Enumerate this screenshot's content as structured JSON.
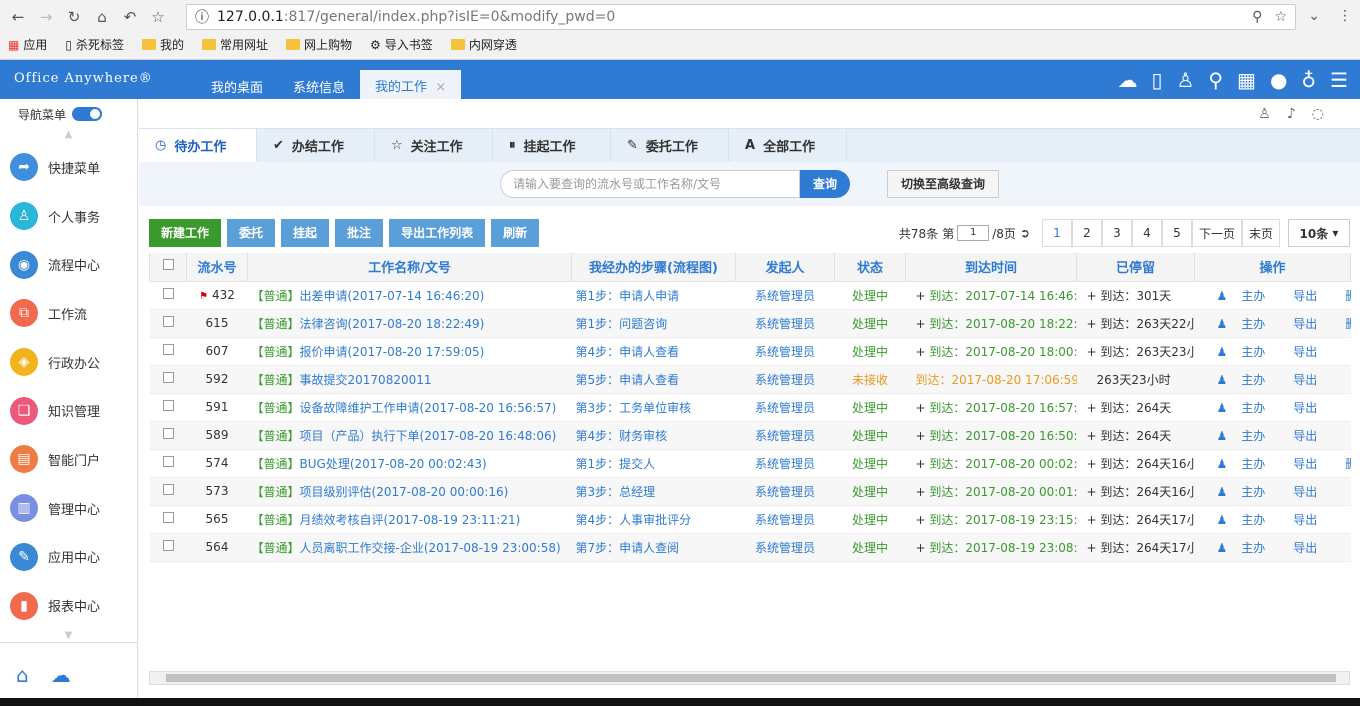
{
  "browser": {
    "url_host": "127.0.0.1",
    "url_rest": ":817/general/index.php?isIE=0&modify_pwd=0",
    "bookmarks": [
      "应用",
      "杀死标签",
      "我的",
      "常用网址",
      "网上购物",
      "导入书签",
      "内网穿透"
    ]
  },
  "app": {
    "logo": "Office Anywhere®",
    "top_tabs": [
      "我的桌面",
      "系统信息",
      "我的工作"
    ],
    "active_tab_close": "×"
  },
  "sidebar": {
    "toggle_label": "导航菜单",
    "items": [
      {
        "label": "快捷菜单",
        "color": "#3f8fdc"
      },
      {
        "label": "个人事务",
        "color": "#29b6d9"
      },
      {
        "label": "流程中心",
        "color": "#3a89d4"
      },
      {
        "label": "工作流",
        "color": "#f26a4e"
      },
      {
        "label": "行政办公",
        "color": "#f2b41e"
      },
      {
        "label": "知识管理",
        "color": "#ec5a7b"
      },
      {
        "label": "智能门户",
        "color": "#ef7c45"
      },
      {
        "label": "管理中心",
        "color": "#7a8fe0"
      },
      {
        "label": "应用中心",
        "color": "#3a89d4"
      },
      {
        "label": "报表中心",
        "color": "#f26a4e"
      }
    ]
  },
  "subtabs": [
    "待办工作",
    "办结工作",
    "关注工作",
    "挂起工作",
    "委托工作",
    "全部工作"
  ],
  "search": {
    "placeholder": "请输入要查询的流水号或工作名称/文号",
    "button": "查询",
    "advanced": "切换至高级查询"
  },
  "actions": [
    "新建工作",
    "委托",
    "挂起",
    "批注",
    "导出工作列表",
    "刷新"
  ],
  "pager": {
    "total": "共78条",
    "page_prefix": "第",
    "page_value": "1",
    "page_suffix": "/8页",
    "pages": [
      "1",
      "2",
      "3",
      "4",
      "5"
    ],
    "next": "下一页",
    "last": "末页",
    "size": "10条"
  },
  "table": {
    "headers": [
      "流水号",
      "工作名称/文号",
      "我经办的步骤(流程图)",
      "发起人",
      "状态",
      "到达时间",
      "已停留",
      "操作"
    ],
    "rows": [
      {
        "id": "432",
        "flag": true,
        "tag": "【普通】",
        "name": "出差申请(2017-07-14 16:46:20)",
        "step": "第1步：申请人申请",
        "user": "系统管理员",
        "status": "处理中",
        "arrive": "到达：2017-07-14 16:46:20",
        "stay": "到达：301天",
        "ops": [
          "主办",
          "导出",
          "删除"
        ]
      },
      {
        "id": "615",
        "tag": "【普通】",
        "name": "法律咨询(2017-08-20 18:22:49)",
        "step": "第1步：问题咨询",
        "user": "系统管理员",
        "status": "处理中",
        "arrive": "到达：2017-08-20 18:22:49",
        "stay": "到达：263天22小时",
        "ops": [
          "主办",
          "导出",
          "删除"
        ]
      },
      {
        "id": "607",
        "tag": "【普通】",
        "name": "报价申请(2017-08-20 17:59:05)",
        "step": "第4步：申请人查看",
        "user": "系统管理员",
        "status": "处理中",
        "arrive": "到达：2017-08-20 18:00:10",
        "stay": "到达：263天23小时",
        "ops": [
          "主办",
          "导出"
        ]
      },
      {
        "id": "592",
        "tag": "【普通】",
        "name": "事故提交20170820011",
        "step": "第5步：申请人查看",
        "user": "系统管理员",
        "status": "未接收",
        "orange": true,
        "arrive": "到达：2017-08-20 17:06:59",
        "stay": "263天23小时",
        "ops": [
          "主办",
          "导出"
        ]
      },
      {
        "id": "591",
        "tag": "【普通】",
        "name": "设备故障维护工作申请(2017-08-20 16:56:57)",
        "step": "第3步：工务单位审核",
        "user": "系统管理员",
        "status": "处理中",
        "arrive": "到达：2017-08-20 16:57:54",
        "stay": "到达：264天",
        "ops": [
          "主办",
          "导出"
        ]
      },
      {
        "id": "589",
        "tag": "【普通】",
        "name": "项目（产品）执行下单(2017-08-20 16:48:06)",
        "step": "第4步：财务审核",
        "user": "系统管理员",
        "status": "处理中",
        "arrive": "到达：2017-08-20 16:50:03",
        "stay": "到达：264天",
        "ops": [
          "主办",
          "导出"
        ]
      },
      {
        "id": "574",
        "tag": "【普通】",
        "name": "BUG处理(2017-08-20 00:02:43)",
        "step": "第1步：提交人",
        "user": "系统管理员",
        "status": "处理中",
        "arrive": "到达：2017-08-20 00:02:43",
        "stay": "到达：264天16小时",
        "ops": [
          "主办",
          "导出",
          "删除"
        ]
      },
      {
        "id": "573",
        "tag": "【普通】",
        "name": "项目级别评估(2017-08-20 00:00:16)",
        "step": "第3步：总经理",
        "user": "系统管理员",
        "status": "处理中",
        "arrive": "到达：2017-08-20 00:01:09",
        "stay": "到达：264天16小时",
        "ops": [
          "主办",
          "导出"
        ]
      },
      {
        "id": "565",
        "tag": "【普通】",
        "name": "月绩效考核自评(2017-08-19 23:11:21)",
        "step": "第4步：人事审批评分",
        "user": "系统管理员",
        "status": "处理中",
        "arrive": "到达：2017-08-19 23:15:00",
        "stay": "到达：264天17小时",
        "ops": [
          "主办",
          "导出"
        ]
      },
      {
        "id": "564",
        "tag": "【普通】",
        "name": "人员离职工作交接-企业(2017-08-19 23:00:58)",
        "step": "第7步：申请人查阅",
        "user": "系统管理员",
        "status": "处理中",
        "arrive": "到达：2017-08-19 23:08:46",
        "stay": "到达：264天17小时",
        "ops": [
          "主办",
          "导出"
        ]
      }
    ]
  }
}
